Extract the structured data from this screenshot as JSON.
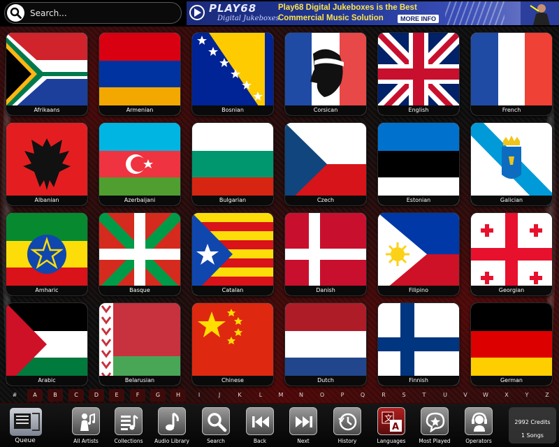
{
  "search": {
    "placeholder": "Search..."
  },
  "banner": {
    "brand": "PLAY68",
    "tagline": "Digital Jukeboxes",
    "headline_1": "Play68 Digital Jukeboxes is the Best",
    "headline_2": "Commercial Music Solution",
    "cta": "MORE INFO"
  },
  "languages": [
    {
      "label": "Afrikaans",
      "flag": "south-africa"
    },
    {
      "label": "Armenian",
      "flag": "armenia"
    },
    {
      "label": "Bosnian",
      "flag": "bosnia"
    },
    {
      "label": "Corsican",
      "flag": "corsica"
    },
    {
      "label": "English",
      "flag": "united-kingdom"
    },
    {
      "label": "French",
      "flag": "france"
    },
    {
      "label": "Albanian",
      "flag": "albania"
    },
    {
      "label": "Azerbaijani",
      "flag": "azerbaijan"
    },
    {
      "label": "Bulgarian",
      "flag": "bulgaria"
    },
    {
      "label": "Czech",
      "flag": "czech-republic"
    },
    {
      "label": "Estonian",
      "flag": "estonia"
    },
    {
      "label": "Galician",
      "flag": "galicia"
    },
    {
      "label": "Amharic",
      "flag": "ethiopia"
    },
    {
      "label": "Basque",
      "flag": "basque-country"
    },
    {
      "label": "Catalan",
      "flag": "catalonia"
    },
    {
      "label": "Danish",
      "flag": "denmark"
    },
    {
      "label": "Filipino",
      "flag": "philippines"
    },
    {
      "label": "Georgian",
      "flag": "georgia"
    },
    {
      "label": "Arabic",
      "flag": "palestine"
    },
    {
      "label": "Belarusian",
      "flag": "belarus"
    },
    {
      "label": "Chinese",
      "flag": "china"
    },
    {
      "label": "Dutch",
      "flag": "netherlands"
    },
    {
      "label": "Finnish",
      "flag": "finland"
    },
    {
      "label": "German",
      "flag": "germany"
    }
  ],
  "alphabet": [
    "#",
    "A",
    "B",
    "C",
    "D",
    "E",
    "F",
    "G",
    "H",
    "I",
    "J",
    "K",
    "L",
    "M",
    "N",
    "O",
    "P",
    "Q",
    "R",
    "S",
    "T",
    "U",
    "V",
    "W",
    "X",
    "Y",
    "Z"
  ],
  "toolbar": {
    "queue": "Queue",
    "buttons": [
      {
        "label": "All   Artists",
        "icon": "artist-icon"
      },
      {
        "label": "Collections",
        "icon": "collections-icon"
      },
      {
        "label": "Audio   Library",
        "icon": "music-note-icon"
      },
      {
        "label": "Search",
        "icon": "search-icon"
      },
      {
        "label": "Back",
        "icon": "back-icon"
      },
      {
        "label": "Next",
        "icon": "next-icon"
      },
      {
        "label": "History",
        "icon": "history-icon"
      },
      {
        "label": "Languages",
        "icon": "translate-icon"
      },
      {
        "label": "Most   Played",
        "icon": "star-bubble-icon"
      },
      {
        "label": "Operators",
        "icon": "headset-icon"
      }
    ]
  },
  "credits": {
    "amount": "2992 Credits",
    "songs": "1 Songs"
  },
  "colors": {
    "accent_red": "#c00000",
    "banner_blue": "#1f3594",
    "banner_yellow": "#ffe44a"
  }
}
